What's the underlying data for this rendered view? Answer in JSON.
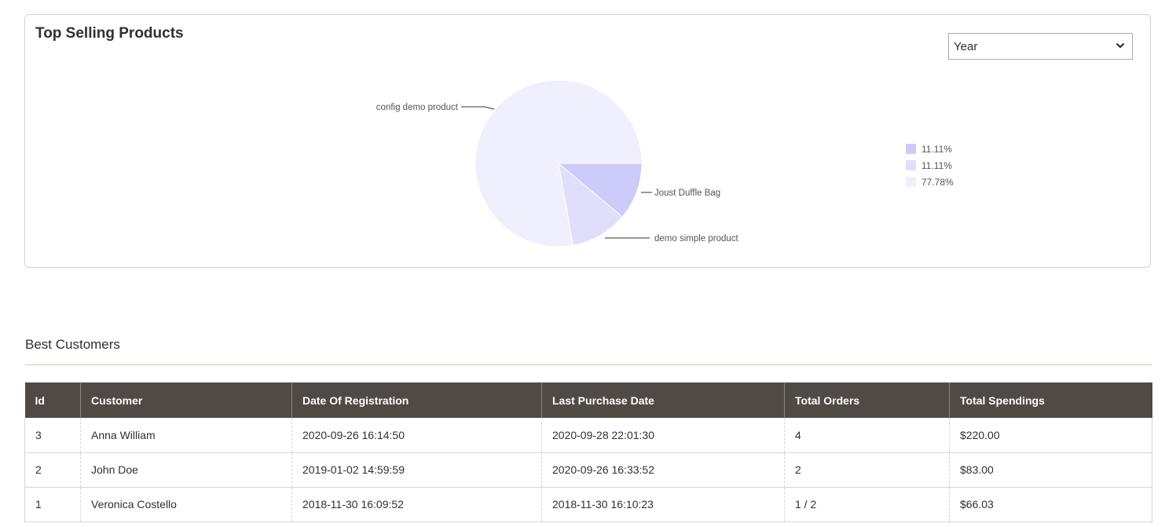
{
  "top_selling": {
    "title": "Top Selling Products",
    "period_select": {
      "selected": "Year",
      "icon": "chevron-down-icon"
    },
    "legend": [
      {
        "label": "11.11%",
        "color": "#cccbf9"
      },
      {
        "label": "11.11%",
        "color": "#dfdefb"
      },
      {
        "label": "77.78%",
        "color": "#f0effe"
      }
    ]
  },
  "chart_data": {
    "type": "pie",
    "slices": [
      {
        "name": "Joust Duffle Bag",
        "value": 11.11,
        "color": "#cccbf9"
      },
      {
        "name": "demo simple product",
        "value": 11.11,
        "color": "#dfdefb"
      },
      {
        "name": "config demo product",
        "value": 77.78,
        "color": "#f0effe"
      }
    ],
    "unit": "%",
    "legend_placement": "right"
  },
  "best_customers": {
    "title": "Best Customers",
    "columns": [
      "Id",
      "Customer",
      "Date Of Registration",
      "Last Purchase Date",
      "Total Orders",
      "Total Spendings"
    ],
    "rows": [
      [
        "3",
        "Anna William",
        "2020-09-26 16:14:50",
        "2020-09-28 22:01:30",
        "4",
        "$220.00"
      ],
      [
        "2",
        "John Doe",
        "2019-01-02 14:59:59",
        "2020-09-26 16:33:52",
        "2",
        "$83.00"
      ],
      [
        "1",
        "Veronica Costello",
        "2018-11-30 16:09:52",
        "2018-11-30 16:10:23",
        "1 / 2",
        "$66.03"
      ]
    ],
    "header_bg": "#514943"
  }
}
